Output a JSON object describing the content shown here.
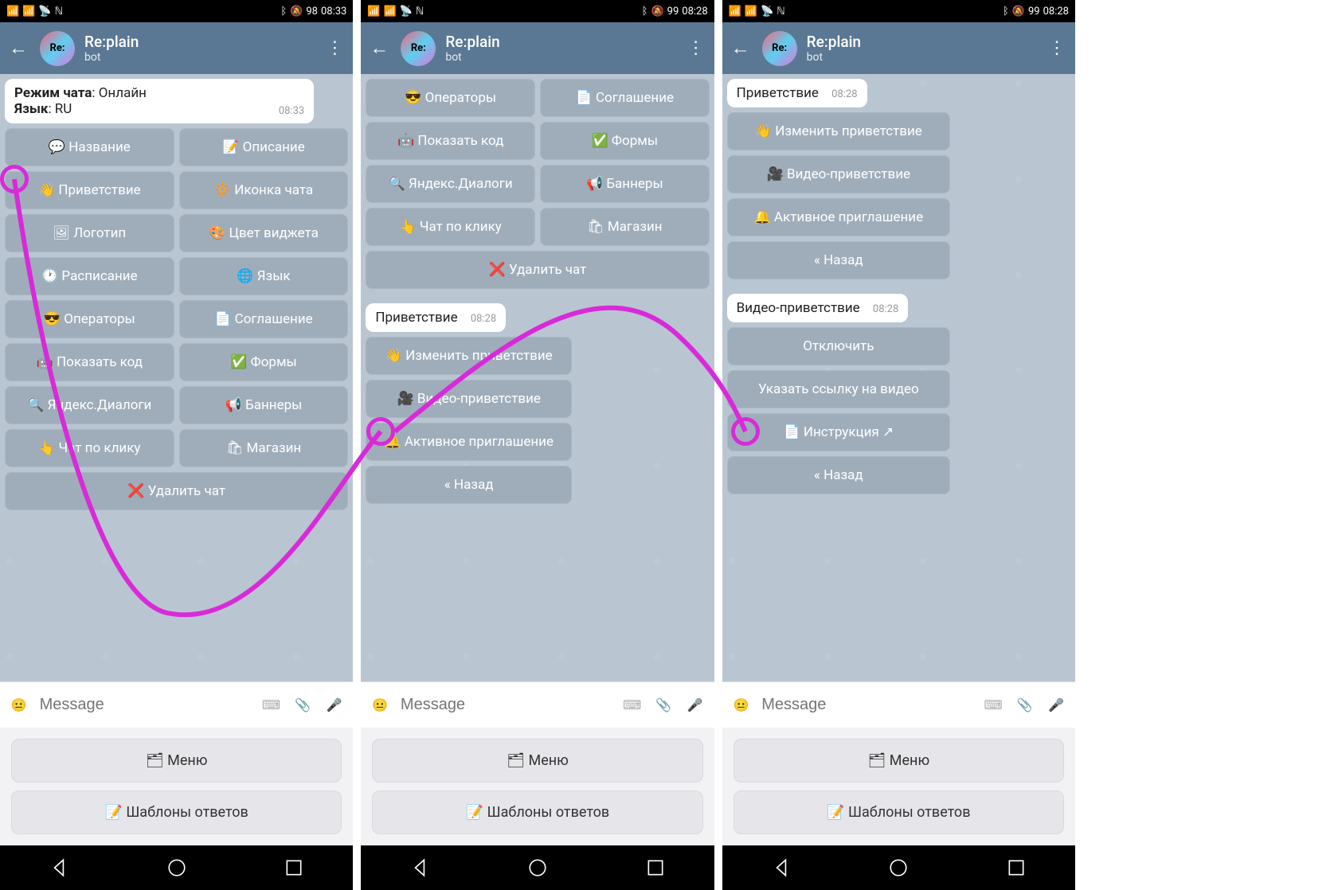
{
  "status": {
    "time1": "08:33",
    "time2": "08:28",
    "time3": "08:28",
    "batt1": "98",
    "batt2": "99",
    "batt3": "99"
  },
  "header": {
    "title": "Re:plain",
    "sub": "bot",
    "avatar_text": "Re:"
  },
  "screen1": {
    "info_chat_mode_label": "Режим чата",
    "info_chat_mode_value": ": Онлайн",
    "info_lang_label": "Язык",
    "info_lang_value": ": RU",
    "info_time": "08:33",
    "buttons": [
      {
        "l": "💬 Название",
        "r": "📝 Описание"
      },
      {
        "l": "👋 Приветствие",
        "r": "🔆 Иконка чата"
      },
      {
        "l": "🖼 Логотип",
        "r": "🎨 Цвет виджета"
      },
      {
        "l": "🕐 Расписание",
        "r": "🌐 Язык"
      },
      {
        "l": "😎 Операторы",
        "r": "📄 Соглашение"
      },
      {
        "l": "🤖 Показать код",
        "r": "✅ Формы"
      },
      {
        "l": "🔍 Яндекс.Диалоги",
        "r": "📢 Баннеры"
      },
      {
        "l": "👆 Чат по клику",
        "r": "🛍 Магазин"
      }
    ],
    "delete": "❌ Удалить чат"
  },
  "screen2": {
    "top_buttons": [
      {
        "l": "😎 Операторы",
        "r": "📄 Соглашение"
      },
      {
        "l": "🤖 Показать код",
        "r": "✅ Формы"
      },
      {
        "l": "🔍 Яндекс.Диалоги",
        "r": "📢 Баннеры"
      },
      {
        "l": "👆 Чат по клику",
        "r": "🛍 Магазин"
      }
    ],
    "delete": "❌ Удалить чат",
    "msg": "Приветствие",
    "msg_time": "08:28",
    "sub_buttons": [
      "👋 Изменить приветствие",
      "🎥 Видео-приветствие",
      "🔔 Активное приглашение",
      "« Назад"
    ]
  },
  "screen3": {
    "msg1": "Приветствие",
    "msg1_time": "08:28",
    "sub1": [
      "👋 Изменить приветствие",
      "🎥 Видео-приветствие",
      "🔔 Активное приглашение",
      "« Назад"
    ],
    "msg2": "Видео-приветствие",
    "msg2_time": "08:28",
    "sub2": [
      "Отключить",
      "Указать ссылку на видео",
      "📄 Инструкция ↗",
      "« Назад"
    ]
  },
  "input": {
    "placeholder": "Message"
  },
  "bottom": {
    "menu": "🗂 Меню",
    "templates": "📝 Шаблоны ответов"
  }
}
